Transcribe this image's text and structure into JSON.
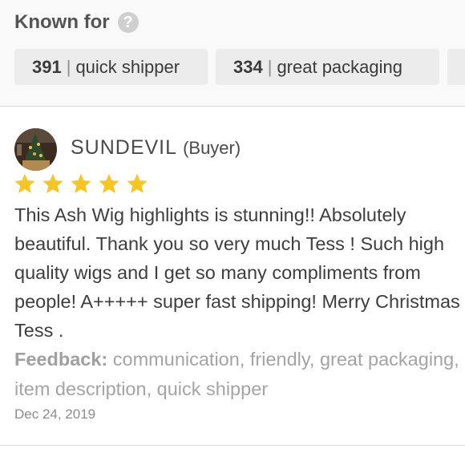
{
  "known_for": {
    "title": "Known for",
    "help_icon": "question-circle-icon",
    "tags": [
      {
        "count": "391",
        "label": "quick shipper"
      },
      {
        "count": "334",
        "label": "great packaging"
      }
    ]
  },
  "review": {
    "username": "SUNDEVIL",
    "role": "(Buyer)",
    "rating": 5,
    "star_color": "#f8c623",
    "text": "This Ash Wig highlights is stunning!! Absolutely beautiful. Thank you so very much Tess ! Such high quality wigs and I get so many compliments from people! A+++++ super fast shipping! Merry Christmas Tess .",
    "feedback_label": "Feedback:",
    "feedback_text": "communication, friendly, great packaging, item description, quick shipper",
    "date": "Dec 24, 2019"
  }
}
